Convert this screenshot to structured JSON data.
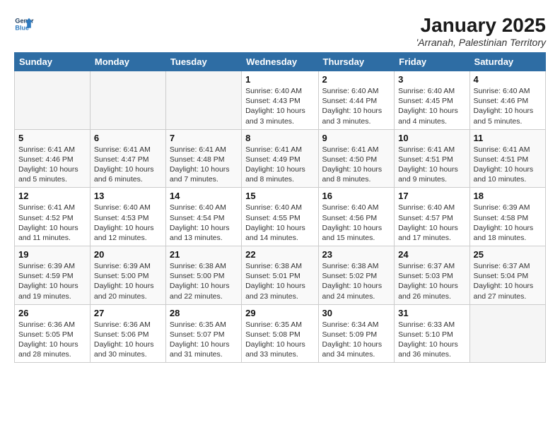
{
  "logo": {
    "line1": "General",
    "line2": "Blue"
  },
  "title": "January 2025",
  "subtitle": "'Arranah, Palestinian Territory",
  "days_of_week": [
    "Sunday",
    "Monday",
    "Tuesday",
    "Wednesday",
    "Thursday",
    "Friday",
    "Saturday"
  ],
  "weeks": [
    [
      {
        "day": "",
        "info": ""
      },
      {
        "day": "",
        "info": ""
      },
      {
        "day": "",
        "info": ""
      },
      {
        "day": "1",
        "info": "Sunrise: 6:40 AM\nSunset: 4:43 PM\nDaylight: 10 hours\nand 3 minutes."
      },
      {
        "day": "2",
        "info": "Sunrise: 6:40 AM\nSunset: 4:44 PM\nDaylight: 10 hours\nand 3 minutes."
      },
      {
        "day": "3",
        "info": "Sunrise: 6:40 AM\nSunset: 4:45 PM\nDaylight: 10 hours\nand 4 minutes."
      },
      {
        "day": "4",
        "info": "Sunrise: 6:40 AM\nSunset: 4:46 PM\nDaylight: 10 hours\nand 5 minutes."
      }
    ],
    [
      {
        "day": "5",
        "info": "Sunrise: 6:41 AM\nSunset: 4:46 PM\nDaylight: 10 hours\nand 5 minutes."
      },
      {
        "day": "6",
        "info": "Sunrise: 6:41 AM\nSunset: 4:47 PM\nDaylight: 10 hours\nand 6 minutes."
      },
      {
        "day": "7",
        "info": "Sunrise: 6:41 AM\nSunset: 4:48 PM\nDaylight: 10 hours\nand 7 minutes."
      },
      {
        "day": "8",
        "info": "Sunrise: 6:41 AM\nSunset: 4:49 PM\nDaylight: 10 hours\nand 8 minutes."
      },
      {
        "day": "9",
        "info": "Sunrise: 6:41 AM\nSunset: 4:50 PM\nDaylight: 10 hours\nand 8 minutes."
      },
      {
        "day": "10",
        "info": "Sunrise: 6:41 AM\nSunset: 4:51 PM\nDaylight: 10 hours\nand 9 minutes."
      },
      {
        "day": "11",
        "info": "Sunrise: 6:41 AM\nSunset: 4:51 PM\nDaylight: 10 hours\nand 10 minutes."
      }
    ],
    [
      {
        "day": "12",
        "info": "Sunrise: 6:41 AM\nSunset: 4:52 PM\nDaylight: 10 hours\nand 11 minutes."
      },
      {
        "day": "13",
        "info": "Sunrise: 6:40 AM\nSunset: 4:53 PM\nDaylight: 10 hours\nand 12 minutes."
      },
      {
        "day": "14",
        "info": "Sunrise: 6:40 AM\nSunset: 4:54 PM\nDaylight: 10 hours\nand 13 minutes."
      },
      {
        "day": "15",
        "info": "Sunrise: 6:40 AM\nSunset: 4:55 PM\nDaylight: 10 hours\nand 14 minutes."
      },
      {
        "day": "16",
        "info": "Sunrise: 6:40 AM\nSunset: 4:56 PM\nDaylight: 10 hours\nand 15 minutes."
      },
      {
        "day": "17",
        "info": "Sunrise: 6:40 AM\nSunset: 4:57 PM\nDaylight: 10 hours\nand 17 minutes."
      },
      {
        "day": "18",
        "info": "Sunrise: 6:39 AM\nSunset: 4:58 PM\nDaylight: 10 hours\nand 18 minutes."
      }
    ],
    [
      {
        "day": "19",
        "info": "Sunrise: 6:39 AM\nSunset: 4:59 PM\nDaylight: 10 hours\nand 19 minutes."
      },
      {
        "day": "20",
        "info": "Sunrise: 6:39 AM\nSunset: 5:00 PM\nDaylight: 10 hours\nand 20 minutes."
      },
      {
        "day": "21",
        "info": "Sunrise: 6:38 AM\nSunset: 5:00 PM\nDaylight: 10 hours\nand 22 minutes."
      },
      {
        "day": "22",
        "info": "Sunrise: 6:38 AM\nSunset: 5:01 PM\nDaylight: 10 hours\nand 23 minutes."
      },
      {
        "day": "23",
        "info": "Sunrise: 6:38 AM\nSunset: 5:02 PM\nDaylight: 10 hours\nand 24 minutes."
      },
      {
        "day": "24",
        "info": "Sunrise: 6:37 AM\nSunset: 5:03 PM\nDaylight: 10 hours\nand 26 minutes."
      },
      {
        "day": "25",
        "info": "Sunrise: 6:37 AM\nSunset: 5:04 PM\nDaylight: 10 hours\nand 27 minutes."
      }
    ],
    [
      {
        "day": "26",
        "info": "Sunrise: 6:36 AM\nSunset: 5:05 PM\nDaylight: 10 hours\nand 28 minutes."
      },
      {
        "day": "27",
        "info": "Sunrise: 6:36 AM\nSunset: 5:06 PM\nDaylight: 10 hours\nand 30 minutes."
      },
      {
        "day": "28",
        "info": "Sunrise: 6:35 AM\nSunset: 5:07 PM\nDaylight: 10 hours\nand 31 minutes."
      },
      {
        "day": "29",
        "info": "Sunrise: 6:35 AM\nSunset: 5:08 PM\nDaylight: 10 hours\nand 33 minutes."
      },
      {
        "day": "30",
        "info": "Sunrise: 6:34 AM\nSunset: 5:09 PM\nDaylight: 10 hours\nand 34 minutes."
      },
      {
        "day": "31",
        "info": "Sunrise: 6:33 AM\nSunset: 5:10 PM\nDaylight: 10 hours\nand 36 minutes."
      },
      {
        "day": "",
        "info": ""
      }
    ]
  ]
}
